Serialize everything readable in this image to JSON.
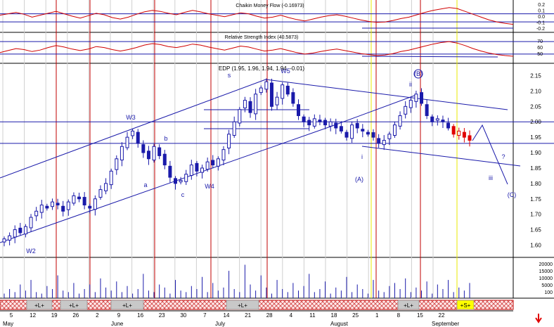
{
  "chart_data": [
    {
      "type": "line",
      "panel": "chaikin",
      "title": "Chaikin Money Flow (-0.16973)",
      "y_ticks": [
        "0.2",
        "0.1",
        "0.0",
        "-0.1",
        "-0.2"
      ],
      "ylim": [
        -0.25,
        0.25
      ],
      "series": [
        {
          "color": "#d00000",
          "values": [
            0.02,
            0.05,
            0.08,
            0.04,
            -0.02,
            0.02,
            0.06,
            0.1,
            0.05,
            0.0,
            -0.04,
            0.01,
            0.06,
            0.03,
            -0.03,
            -0.06,
            -0.02,
            0.04,
            0.09,
            0.12,
            0.1,
            0.06,
            0.03,
            0.08,
            0.12,
            0.09,
            0.05,
            0.02,
            -0.01,
            0.03,
            0.07,
            0.05,
            0.0,
            -0.04,
            -0.02,
            0.02,
            -0.03,
            -0.07,
            -0.1,
            -0.06,
            -0.02,
            0.01,
            0.03,
            0.0,
            -0.04,
            -0.08,
            -0.11,
            -0.13,
            -0.12,
            -0.09,
            -0.05,
            -0.02,
            0.03,
            0.08,
            0.12,
            0.15,
            0.18,
            0.16,
            0.1,
            0.04,
            -0.02,
            -0.08,
            -0.12,
            -0.15,
            -0.17
          ]
        }
      ]
    },
    {
      "type": "line",
      "panel": "rsi",
      "title": "Relative Strength Index (40.5873)",
      "y_ticks": [
        "70",
        "60",
        "50"
      ],
      "ylim": [
        35,
        80
      ],
      "series": [
        {
          "color": "#d00000",
          "values": [
            48,
            52,
            56,
            54,
            50,
            53,
            58,
            62,
            59,
            55,
            52,
            55,
            60,
            58,
            54,
            51,
            54,
            58,
            63,
            66,
            64,
            60,
            58,
            61,
            65,
            63,
            59,
            56,
            53,
            57,
            61,
            59,
            55,
            51,
            53,
            56,
            52,
            48,
            45,
            47,
            50,
            53,
            55,
            52,
            49,
            46,
            44,
            42,
            43,
            46,
            50,
            53,
            57,
            61,
            65,
            68,
            70,
            67,
            62,
            56,
            51,
            47,
            44,
            42,
            40.6
          ]
        }
      ]
    },
    {
      "type": "candlestick",
      "panel": "price",
      "title": "EDP (1.95, 1.96, 1.94, 1.94, -0.01)",
      "y_ticks": [
        "2.15",
        "2.10",
        "2.05",
        "2.00",
        "1.95",
        "1.90",
        "1.85",
        "1.80",
        "1.75",
        "1.70",
        "1.65",
        "1.60"
      ],
      "ylim": [
        1.56,
        2.19
      ],
      "x_ticks": [
        "5",
        "12",
        "19",
        "26",
        "2",
        "9",
        "16",
        "23",
        "30",
        "7",
        "14",
        "21",
        "28",
        "4",
        "11",
        "18",
        "25",
        "1",
        "8",
        "15",
        "22"
      ],
      "months": [
        "May",
        "June",
        "July",
        "August",
        "September"
      ],
      "closes": [
        1.62,
        1.63,
        1.65,
        1.64,
        1.66,
        1.69,
        1.71,
        1.73,
        1.72,
        1.74,
        1.73,
        1.71,
        1.74,
        1.76,
        1.75,
        1.73,
        1.72,
        1.75,
        1.78,
        1.8,
        1.84,
        1.88,
        1.92,
        1.95,
        1.97,
        1.93,
        1.9,
        1.88,
        1.92,
        1.89,
        1.86,
        1.82,
        1.8,
        1.81,
        1.83,
        1.86,
        1.84,
        1.85,
        1.87,
        1.86,
        1.88,
        1.91,
        1.96,
        2.0,
        2.04,
        2.07,
        2.03,
        2.09,
        2.11,
        2.13,
        2.05,
        2.08,
        2.12,
        2.09,
        2.06,
        2.02,
        2.0,
        1.99,
        2.01,
        2.0,
        1.99,
        2.0,
        1.98,
        1.97,
        1.95,
        1.99,
        1.98,
        1.97,
        1.96,
        1.95,
        1.93,
        1.94,
        1.96,
        1.99,
        2.02,
        2.05,
        2.07,
        2.09,
        2.06,
        2.02,
        2.0,
        2.01,
        2.0,
        1.98,
        1.96,
        1.97,
        1.95,
        1.94
      ],
      "wave_labels": [
        "W2",
        "W3",
        "a",
        "b",
        "c",
        "W4",
        "s",
        "W5",
        "s",
        "(A)",
        "i",
        "ii",
        "(B)",
        "iii",
        "?",
        "(C)"
      ]
    },
    {
      "type": "bar",
      "panel": "volume",
      "y_ticks": [
        "20000",
        "15000",
        "10000",
        "5000",
        "100"
      ],
      "ylim": [
        0,
        25000
      ],
      "values": [
        3000,
        6000,
        4000,
        9000,
        5000,
        12000,
        4000,
        3000,
        8000,
        6000,
        15000,
        5000,
        4000,
        10000,
        3000,
        6000,
        9000,
        4000,
        13000,
        7000,
        5000,
        11000,
        4000,
        8000,
        3000,
        6000,
        16000,
        5000,
        4000,
        9000,
        7000,
        3000,
        12000,
        5000,
        4000,
        8000,
        6000,
        14000,
        4000,
        10000,
        5000,
        7000,
        18000,
        6000,
        4000,
        22000,
        9000,
        5000,
        15000,
        7000,
        3000,
        12000,
        6000,
        4000,
        10000,
        5000,
        8000,
        16000,
        4000,
        6000,
        11000,
        3000,
        7000,
        5000,
        14000,
        4000,
        9000,
        6000,
        3000,
        12000,
        5000,
        4000,
        8000,
        10000,
        6000,
        13000,
        4000,
        7000,
        5000,
        11000,
        3000,
        9000,
        6000,
        12000,
        4000,
        7000,
        5000,
        10000
      ]
    }
  ],
  "signal_strip": {
    "labels": [
      "+L+",
      "+L+",
      "+L+",
      "+L+",
      "+L+",
      "+S+"
    ]
  }
}
